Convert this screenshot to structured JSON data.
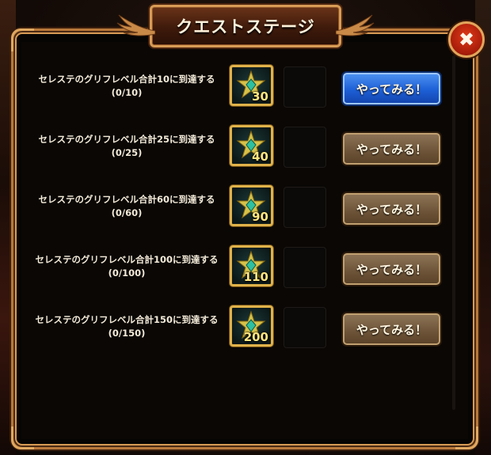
{
  "header": {
    "title": "クエストステージ"
  },
  "close": {
    "glyph": "✖"
  },
  "quests": [
    {
      "label": "セレステのグリフレベル合計10に到達する",
      "progress": "(0/10)",
      "reward_amount": "30",
      "button_label": "やってみる！",
      "button_state": "active"
    },
    {
      "label": "セレステのグリフレベル合計25に到達する",
      "progress": "(0/25)",
      "reward_amount": "40",
      "button_label": "やってみる！",
      "button_state": "inactive"
    },
    {
      "label": "セレステのグリフレベル合計60に到達する",
      "progress": "(0/60)",
      "reward_amount": "90",
      "button_label": "やってみる！",
      "button_state": "inactive"
    },
    {
      "label": "セレステのグリフレベル合計100に到達する",
      "progress": "(0/100)",
      "reward_amount": "110",
      "button_label": "やってみる！",
      "button_state": "inactive"
    },
    {
      "label": "セレステのグリフレベル合計150に到達する",
      "progress": "(0/150)",
      "reward_amount": "200",
      "button_label": "やってみる！",
      "button_state": "inactive"
    }
  ],
  "reward_icon": "star-crystal-icon",
  "colors": {
    "active_button": "#1d5fd6",
    "inactive_button": "#6d5438",
    "frame_gold": "#d79b55",
    "reward_number": "#ffe680"
  }
}
